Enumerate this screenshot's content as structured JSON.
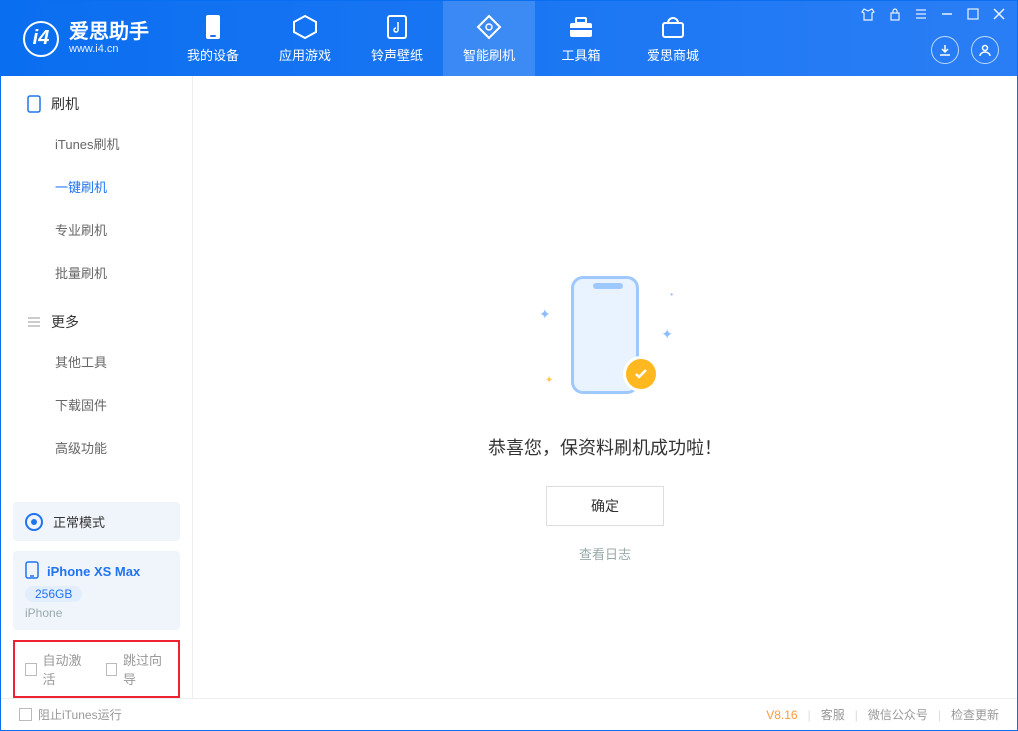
{
  "app": {
    "title": "爱思助手",
    "subtitle": "www.i4.cn",
    "logo_letter": "i4"
  },
  "nav": {
    "items": [
      {
        "label": "我的设备",
        "icon": "device-icon"
      },
      {
        "label": "应用游戏",
        "icon": "apps-icon"
      },
      {
        "label": "铃声壁纸",
        "icon": "music-icon"
      },
      {
        "label": "智能刷机",
        "icon": "flash-icon",
        "active": true
      },
      {
        "label": "工具箱",
        "icon": "toolbox-icon"
      },
      {
        "label": "爱思商城",
        "icon": "store-icon"
      }
    ]
  },
  "sidebar": {
    "group1_label": "刷机",
    "group1_items": [
      {
        "label": "iTunes刷机"
      },
      {
        "label": "一键刷机",
        "active": true
      },
      {
        "label": "专业刷机"
      },
      {
        "label": "批量刷机"
      }
    ],
    "group2_label": "更多",
    "group2_items": [
      {
        "label": "其他工具"
      },
      {
        "label": "下载固件"
      },
      {
        "label": "高级功能"
      }
    ],
    "mode_label": "正常模式",
    "device_name": "iPhone XS Max",
    "device_storage": "256GB",
    "device_type": "iPhone",
    "checkbox1": "自动激活",
    "checkbox2": "跳过向导"
  },
  "main": {
    "success_text": "恭喜您，保资料刷机成功啦！",
    "ok_button": "确定",
    "log_link": "查看日志"
  },
  "footer": {
    "block_itunes": "阻止iTunes运行",
    "version": "V8.16",
    "link1": "客服",
    "link2": "微信公众号",
    "link3": "检查更新"
  }
}
